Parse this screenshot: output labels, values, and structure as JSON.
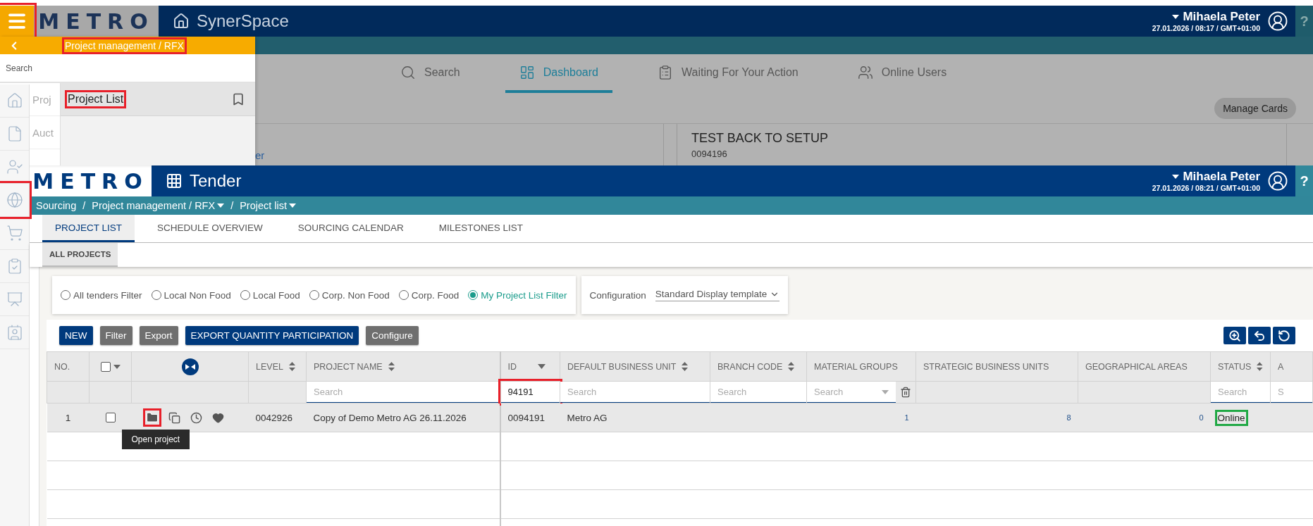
{
  "dashboard": {
    "menu_button": {
      "frame": {
        "color": "#e8202a"
      }
    },
    "logo": "METRO",
    "title": "SynerSpace",
    "user": {
      "name": "Mihaela Peter",
      "meta": "27.01.2026 / 08:17 / GMT+01:00"
    },
    "help": "?",
    "nav": [
      {
        "label": "Search",
        "kind": "search",
        "selected": false
      },
      {
        "label": "Dashboard",
        "kind": "dashboard",
        "selected": true
      },
      {
        "label": "Waiting For Your Action",
        "kind": "clipboard",
        "selected": false
      },
      {
        "label": "Online Users",
        "kind": "users",
        "selected": false
      }
    ],
    "manage_cards": "Manage Cards",
    "partial_link": "er",
    "card": {
      "title": "TEST BACK TO SETUP",
      "number": "0094196"
    }
  },
  "menu": {
    "title": "Project management / RFX",
    "title_frame": {
      "color": "#e8202a"
    },
    "search_placeholder": "Search",
    "sidebar": [
      {
        "kind": "home"
      },
      {
        "kind": "document"
      },
      {
        "kind": "person"
      },
      {
        "kind": "globe",
        "frame": {
          "color": "#e8202a"
        }
      },
      {
        "kind": "cart"
      },
      {
        "kind": "clipboard"
      },
      {
        "kind": "presentation"
      },
      {
        "kind": "contact"
      }
    ],
    "sections": [
      "Proj",
      "Auct"
    ],
    "items": [
      {
        "label": "Project List",
        "selected": true,
        "frame": {
          "color": "#e8202a"
        }
      }
    ]
  },
  "tender": {
    "logo": "METRO",
    "title": "Tender",
    "user": {
      "name": "Mihaela Peter",
      "meta": "27.01.2026 / 08:21 / GMT+01:00"
    },
    "help": "?",
    "breadcrumb": {
      "separator": "/",
      "items": [
        {
          "label": "Sourcing",
          "dropdown": false
        },
        {
          "label": "Project management / RFX",
          "dropdown": true
        },
        {
          "label": "Project list",
          "dropdown": true
        }
      ]
    },
    "tabs": [
      {
        "label": "PROJECT LIST",
        "selected": true
      },
      {
        "label": "SCHEDULE OVERVIEW",
        "selected": false
      },
      {
        "label": "SOURCING CALENDAR",
        "selected": false
      },
      {
        "label": "MILESTONES LIST",
        "selected": false
      }
    ],
    "subtabs": [
      {
        "label": "ALL PROJECTS",
        "selected": true
      }
    ],
    "filters": [
      {
        "label": "All tenders Filter",
        "selected": false
      },
      {
        "label": "Local Non Food",
        "selected": false
      },
      {
        "label": "Local Food",
        "selected": false
      },
      {
        "label": "Corp. Non Food",
        "selected": false
      },
      {
        "label": "Corp. Food",
        "selected": false
      },
      {
        "label": "My Project List Filter",
        "selected": true
      }
    ],
    "configuration": {
      "label": "Configuration",
      "value": "Standard Display template"
    },
    "toolbar": [
      {
        "label": "NEW",
        "kind": "primary"
      },
      {
        "label": "Filter",
        "kind": "secondary"
      },
      {
        "label": "Export",
        "kind": "secondary"
      },
      {
        "label": "EXPORT QUANTITY PARTICIPATION",
        "kind": "primary"
      },
      {
        "label": "Configure",
        "kind": "secondary"
      }
    ],
    "tools": [
      {
        "kind": "zoom"
      },
      {
        "kind": "undo"
      },
      {
        "kind": "reset"
      }
    ],
    "table": {
      "columns": [
        {
          "kind": "text",
          "label": "NO.",
          "sortable": false
        },
        {
          "kind": "select_all",
          "checked": false
        },
        {
          "kind": "toggle"
        },
        {
          "kind": "text",
          "label": "LEVEL",
          "sortable": true,
          "sorted": false
        },
        {
          "kind": "text",
          "label": "PROJECT NAME",
          "sortable": true,
          "sorted": false
        },
        {
          "kind": "text",
          "label": "ID",
          "sortable": true,
          "sorted": true
        },
        {
          "kind": "text",
          "label": "DEFAULT BUSINESS UNIT",
          "sortable": true,
          "sorted": false
        },
        {
          "kind": "text",
          "label": "BRANCH CODE",
          "sortable": true,
          "sorted": false
        },
        {
          "kind": "text",
          "label": "MATERIAL GROUPS",
          "sortable": false
        },
        {
          "kind": "text",
          "label": "STRATEGIC BUSINESS UNITS",
          "sortable": false
        },
        {
          "kind": "text",
          "label": "GEOGRAPHICAL AREAS",
          "sortable": false
        },
        {
          "kind": "text",
          "label": "STATUS",
          "sortable": true,
          "sorted": false
        },
        {
          "kind": "text",
          "label": "A",
          "sortable": false
        }
      ],
      "search_row": [
        {
          "kind": "none"
        },
        {
          "kind": "none"
        },
        {
          "kind": "none"
        },
        {
          "kind": "none"
        },
        {
          "kind": "input",
          "placeholder": "Search"
        },
        {
          "kind": "input",
          "value": "94191",
          "frame": {
            "color": "#e8202a"
          }
        },
        {
          "kind": "input",
          "placeholder": "Search"
        },
        {
          "kind": "input",
          "placeholder": "Search"
        },
        {
          "kind": "select",
          "placeholder": "Search"
        },
        {
          "kind": "none"
        },
        {
          "kind": "none"
        },
        {
          "kind": "input",
          "placeholder": "Search"
        },
        {
          "kind": "input",
          "placeholder": "S"
        }
      ],
      "rows": [
        {
          "hovered": true,
          "cells": [
            {
              "kind": "index",
              "text": "1"
            },
            {
              "kind": "checkbox",
              "checked": false
            },
            {
              "kind": "actions",
              "tooltip": "Open project",
              "frame": {
                "color": "#e8202a"
              }
            },
            {
              "kind": "text",
              "text": "0042926"
            },
            {
              "kind": "text",
              "text": "Copy of Demo Metro AG 26.11.2026"
            },
            {
              "kind": "text",
              "text": "0094191"
            },
            {
              "kind": "text",
              "text": "Metro AG"
            },
            {
              "kind": "empty"
            },
            {
              "kind": "count",
              "text": "1"
            },
            {
              "kind": "count",
              "text": "8"
            },
            {
              "kind": "count",
              "text": "0"
            },
            {
              "kind": "text",
              "text": "Online",
              "frame": {
                "color": "#21a945"
              }
            },
            {
              "kind": "empty"
            }
          ]
        }
      ]
    }
  }
}
